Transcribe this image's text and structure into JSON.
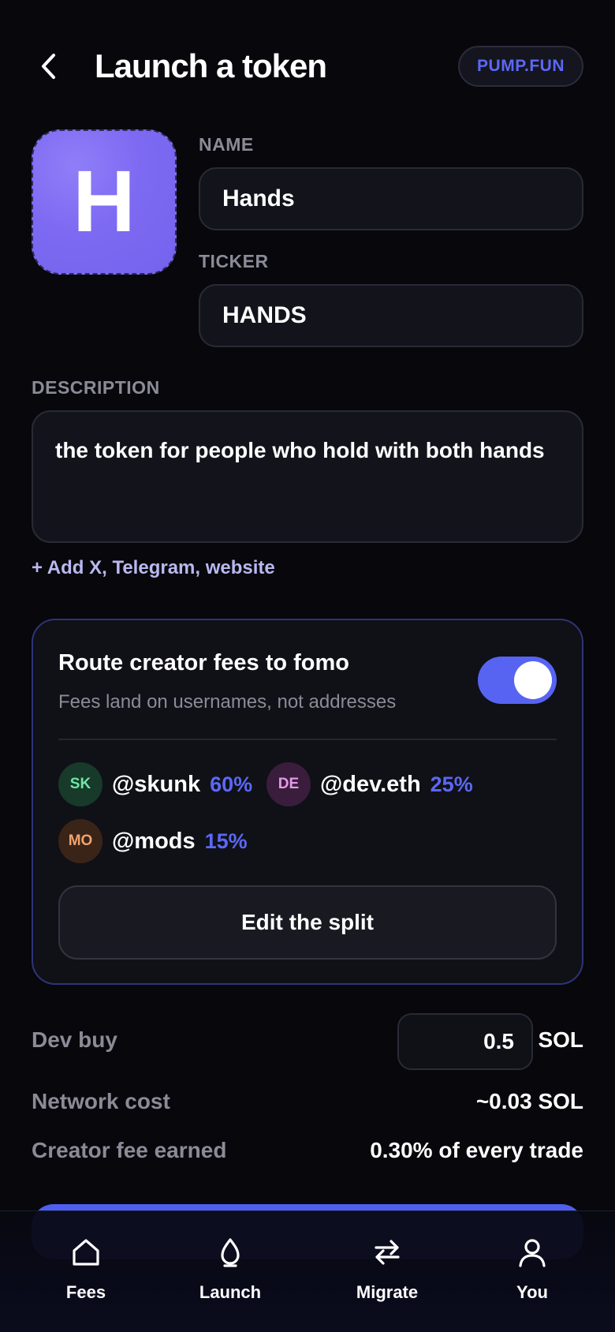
{
  "header": {
    "title": "Launch a token",
    "platform_pill": "PUMP.FUN"
  },
  "token": {
    "image_letter": "H",
    "name_label": "NAME",
    "name_value": "Hands",
    "ticker_label": "TICKER",
    "ticker_value": "HANDS",
    "description_label": "DESCRIPTION",
    "description_value": "the token for people who hold with both hands",
    "add_links": "+ Add X, Telegram, website"
  },
  "fee_routing": {
    "title": "Route creator fees to fomo",
    "subtitle": "Fees land on usernames, not addresses",
    "enabled": true,
    "recipients": [
      {
        "initials": "SK",
        "handle": "@skunk",
        "percent": "60%",
        "avatar_bg": "#173a2a",
        "avatar_fg": "#6ee7a8"
      },
      {
        "initials": "DE",
        "handle": "@dev.eth",
        "percent": "25%",
        "avatar_bg": "#3a1d3d",
        "avatar_fg": "#e59ae8"
      },
      {
        "initials": "MO",
        "handle": "@mods",
        "percent": "15%",
        "avatar_bg": "#3a2418",
        "avatar_fg": "#f0a36e"
      }
    ],
    "edit_button": "Edit the split"
  },
  "summary": {
    "dev_buy_label": "Dev buy",
    "dev_buy_value": "0.5",
    "dev_buy_unit": "SOL",
    "network_cost_label": "Network cost",
    "network_cost_value": "~0.03 SOL",
    "creator_fee_label": "Creator fee earned",
    "creator_fee_value": "0.30% of every trade"
  },
  "nav": {
    "items": [
      {
        "label": "Fees",
        "icon": "home-icon"
      },
      {
        "label": "Launch",
        "icon": "drop-icon"
      },
      {
        "label": "Migrate",
        "icon": "swap-arrows-icon"
      },
      {
        "label": "You",
        "icon": "user-icon"
      }
    ]
  },
  "colors": {
    "background": "#07070c",
    "accent": "#5b68f5",
    "muted_text": "#8b8b98",
    "token_image": "#7d6af2"
  }
}
